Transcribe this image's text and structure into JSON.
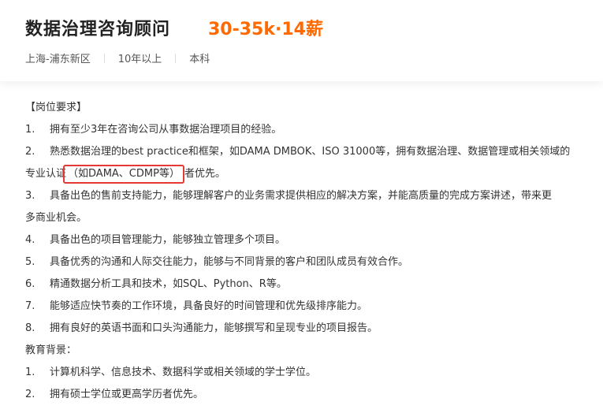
{
  "header": {
    "title": "数据治理咨询顾问",
    "salary": "30-35k·14薪",
    "meta": [
      "上海-浦东新区",
      "10年以上",
      "本科"
    ]
  },
  "requirements": {
    "heading": "【岗位要求】",
    "items": [
      {
        "num": "1.",
        "text": "拥有至少3年在咨询公司从事数据治理项目的经验。"
      },
      {
        "num": "2.",
        "text_line1": "熟悉数据治理的best practice和框架，如DAMA DMBOK、ISO 31000等，拥有数据治理、数据管理或相关领域的",
        "text_pre": "专业认证",
        "text_hl": "（如DAMA、CDMP等）",
        "text_post": "者优先。"
      },
      {
        "num": "3.",
        "text_line1": "具备出色的售前支持能力，能够理解客户的业务需求提供相应的解决方案，并能高质量的完成方案讲述，带来更",
        "text_line2": "多商业机会。"
      },
      {
        "num": "4.",
        "text": "具备出色的项目管理能力，能够独立管理多个项目。"
      },
      {
        "num": "5.",
        "text": "具备优秀的沟通和人际交往能力，能够与不同背景的客户和团队成员有效合作。"
      },
      {
        "num": "6.",
        "text": "精通数据分析工具和技术，如SQL、Python、R等。"
      },
      {
        "num": "7.",
        "text": "能够适应快节奏的工作环境，具备良好的时间管理和优先级排序能力。"
      },
      {
        "num": "8.",
        "text": "拥有良好的英语书面和口头沟通能力，能够撰写和呈现专业的项目报告。"
      }
    ]
  },
  "education": {
    "heading": "教育背景：",
    "items": [
      {
        "num": "1.",
        "text": "计算机科学、信息技术、数据科学或相关领域的学士学位。"
      },
      {
        "num": "2.",
        "text": "拥有硕士学位或更高学历者优先。"
      }
    ]
  },
  "colors": {
    "salary": "#ff6a00",
    "highlight_border": "#e53935"
  }
}
